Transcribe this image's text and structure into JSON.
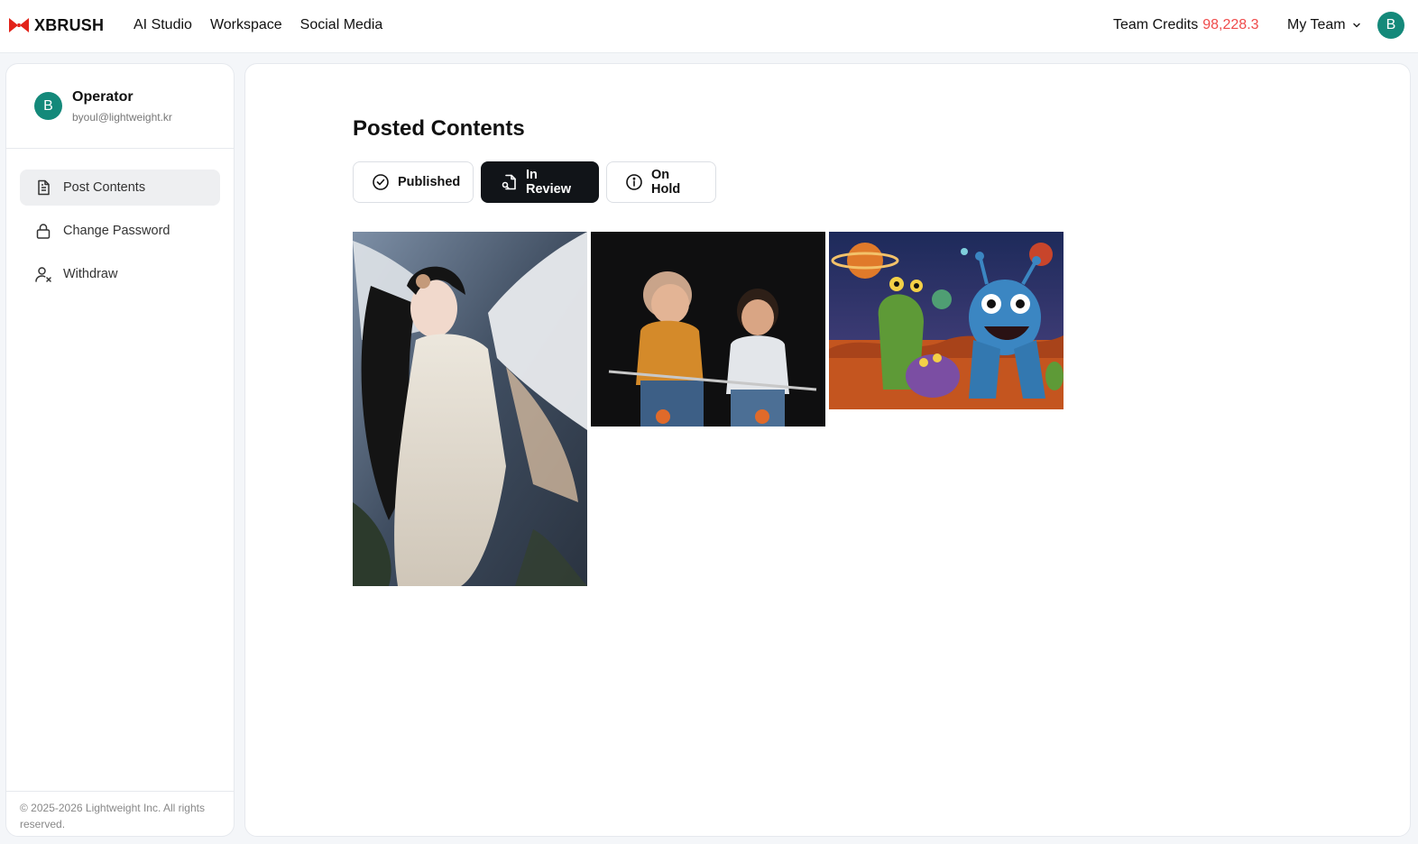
{
  "header": {
    "logo_text": "XBRUSH",
    "nav": [
      "AI Studio",
      "Workspace",
      "Social Media"
    ],
    "credits_label": "Team Credits",
    "credits_value": "98,228.3",
    "team_label": "My Team",
    "avatar_letter": "B"
  },
  "sidebar": {
    "profile": {
      "avatar_letter": "B",
      "name": "Operator",
      "email": "byoul@lightweight.kr"
    },
    "items": [
      {
        "label": "Post Contents",
        "icon": "document-icon",
        "active": true
      },
      {
        "label": "Change Password",
        "icon": "lock-icon",
        "active": false
      },
      {
        "label": "Withdraw",
        "icon": "user-remove-icon",
        "active": false
      }
    ],
    "footer": "© 2025-2026 Lightweight Inc. All rights reserved."
  },
  "main": {
    "title": "Posted Contents",
    "tabs": [
      {
        "label": "Published",
        "icon": "check-circle-icon",
        "active": false
      },
      {
        "label": "In Review",
        "icon": "document-search-icon",
        "active": true
      },
      {
        "label": "On Hold",
        "icon": "info-circle-icon",
        "active": false
      }
    ],
    "images": [
      {
        "subject": "angel-girl-image"
      },
      {
        "subject": "kids-on-bikes-image"
      },
      {
        "subject": "space-monsters-image"
      }
    ]
  },
  "colors": {
    "accent_red": "#ef4b4b",
    "avatar_teal": "#14897a",
    "active_tab_bg": "#111418"
  }
}
